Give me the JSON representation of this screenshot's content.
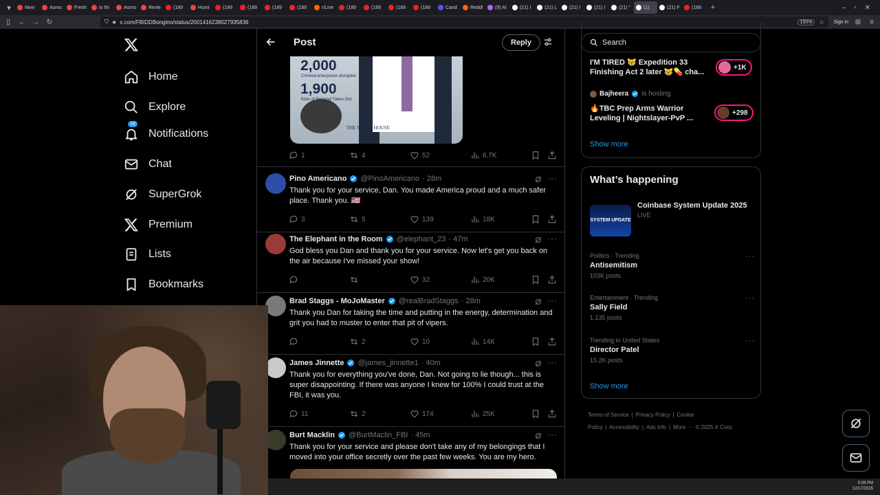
{
  "browser": {
    "tabs": [
      "New",
      "Asmo",
      "Fresh",
      "Is thi",
      "Asmo",
      "Revie",
      "(189",
      "Humi",
      "(189",
      "(189",
      "(189",
      "(189",
      "r/Live",
      "(189",
      "(189",
      "(189",
      "(189",
      "Cand",
      "Reddi",
      "(9) Al",
      "(21) I",
      "(21) L",
      "(21) I",
      "(21) I",
      "(21) \"",
      "(1) ",
      "(21) F",
      "(189"
    ],
    "tab_favicon_colors": [
      "#e44",
      "#e44",
      "#e44",
      "#e44",
      "#e44",
      "#e44",
      "#e22",
      "#e44",
      "#e22",
      "#e22",
      "#e22",
      "#e22",
      "#f60",
      "#e22",
      "#e22",
      "#e22",
      "#e22",
      "#55f",
      "#f60",
      "#a6f",
      "#fff",
      "#fff",
      "#fff",
      "#fff",
      "#fff",
      "#fff",
      "#fff",
      "#e22"
    ],
    "active_tab_index": 25,
    "url": "x.com/FBIDDBongino/status/2001416238027935836",
    "zoom": "150%",
    "signin_label": "Sign in"
  },
  "sidebar": {
    "items": [
      {
        "label": "Home",
        "icon": "home-icon"
      },
      {
        "label": "Explore",
        "icon": "search-icon"
      },
      {
        "label": "Notifications",
        "icon": "bell-icon",
        "badge": "18"
      },
      {
        "label": "Chat",
        "icon": "mail-icon"
      },
      {
        "label": "SuperGrok",
        "icon": "grok-icon"
      },
      {
        "label": "Premium",
        "icon": "x-icon"
      },
      {
        "label": "Lists",
        "icon": "list-icon"
      },
      {
        "label": "Bookmarks",
        "icon": "bookmark-icon"
      }
    ]
  },
  "header": {
    "title": "Post",
    "reply_label": "Reply"
  },
  "media_post": {
    "stat1_value": "2,000",
    "stat1_caption": "Criminal enterprises disrupted",
    "stat2_value": "1,900",
    "stat2_caption": "Kilos of Fentanyl Taken Out",
    "watermark": "THE WHITE HOUSE",
    "actions": {
      "replies": "1",
      "reposts": "4",
      "likes": "52",
      "views": "6.7K"
    }
  },
  "replies": [
    {
      "name": "Pino Americano",
      "handle": "@PinoAmericano",
      "time": "· 28m",
      "text": "Thank you for your service, Dan. You made America proud and a much safer place. Thank you. 🇺🇸",
      "actions": {
        "replies": "3",
        "reposts": "5",
        "likes": "139",
        "views": "18K"
      },
      "avatar_color": "#2c4ea8"
    },
    {
      "name": "The Elephant in the Room",
      "handle": "@elephant_23",
      "time": "· 47m",
      "text": "God bless you Dan and thank you for your service. Now let's get you back on the air because I've missed your show!",
      "actions": {
        "replies": "",
        "reposts": "",
        "likes": "32",
        "views": "20K"
      },
      "avatar_color": "#9b3a3a"
    },
    {
      "name": "Brad Staggs - MoJoMaster",
      "handle": "@realBradStaggs",
      "time": "· 28m",
      "text": "Thank you Dan for taking the time and putting in the energy, determination and grit you had to muster to enter that pit of vipers.",
      "actions": {
        "replies": "",
        "reposts": "2",
        "likes": "10",
        "views": "14K"
      },
      "avatar_color": "#7a7a7a"
    },
    {
      "name": "James Jinnette",
      "handle": "@james_jinnette1",
      "time": "· 40m",
      "text": "Thank you for everything you've done, Dan. Not going to lie though... this is super disappointing. If there was anyone I knew for 100% I could trust at the FBI, it was you.",
      "actions": {
        "replies": "11",
        "reposts": "2",
        "likes": "174",
        "views": "25K"
      },
      "avatar_color": "#c9c9c9"
    },
    {
      "name": "Burt Macklin",
      "handle": "@BurtMaclin_FBI",
      "time": "· 45m",
      "text": "Thank you for your service and please don't take any of my belongings that I moved into your office secretly over the past few weeks. You are my hero.",
      "actions": {
        "replies": "",
        "reposts": "",
        "likes": "",
        "views": ""
      },
      "avatar_color": "#3a3a2a"
    }
  ],
  "right": {
    "search_placeholder": "Search",
    "live": [
      {
        "title": "I'M TIRED 😿 Expedition 33 Finishing Act 2 later 😿💊 cha...",
        "count": "+1K"
      },
      {
        "host": "Bajheera",
        "host_suffix": "is hosting",
        "title": "🔥TBC Prep Arms Warrior Leveling | Nightslayer-PvP ...",
        "count": "+298"
      }
    ],
    "show_more": "Show more",
    "whats_happening_title": "What’s happening",
    "event": {
      "title": "Coinbase System Update 2025",
      "status": "LIVE",
      "thumb_text": "SYSTEM UPDATE"
    },
    "trends": [
      {
        "category": "Politics · Trending",
        "name": "Antisemitism",
        "count": "103K posts"
      },
      {
        "category": "Entertainment · Trending",
        "name": "Sally Field",
        "count": "1,135 posts"
      },
      {
        "category": "Trending in United States",
        "name": "Director Patel",
        "count": "15.2K posts"
      }
    ],
    "footer": [
      "Terms of Service",
      "|",
      "Privacy Policy",
      "|",
      "Cookie Policy",
      "|",
      "Accessibility",
      "|",
      "Ads info",
      "|",
      "More ···",
      "© 2025 X Corp."
    ]
  },
  "taskbar": {
    "time": "5:09 PM",
    "date": "12/17/2025"
  }
}
